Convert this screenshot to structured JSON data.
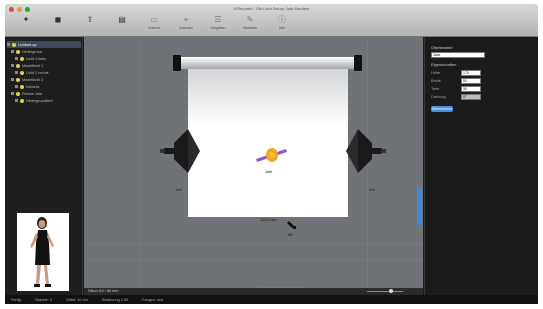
{
  "window": {
    "title": "A Reporter - Ein Licht Set-up Jule-Sanders"
  },
  "toolbar": {
    "tools": [
      {
        "label": "",
        "icon": "light-add-icon"
      },
      {
        "label": "",
        "icon": "camera-add-icon"
      },
      {
        "label": "",
        "icon": "export-icon"
      },
      {
        "label": "",
        "icon": "print-icon"
      },
      {
        "label": "Ansicht",
        "icon": "view-icon"
      },
      {
        "label": "Auswahl",
        "icon": "select-icon"
      },
      {
        "label": "Vorgaben",
        "icon": "presets-icon"
      },
      {
        "label": "Hinweise",
        "icon": "notes-icon"
      },
      {
        "label": "Info",
        "icon": "info-icon"
      }
    ]
  },
  "tree": {
    "rows": [
      {
        "label": "Lichtset-up",
        "selected": true
      },
      {
        "label": "Hintergrund",
        "selected": false
      },
      {
        "label": "Licht 1 links",
        "selected": false
      },
      {
        "label": "Modelllicht 1",
        "selected": false
      },
      {
        "label": "Licht 2 rechts",
        "selected": false
      },
      {
        "label": "Modelllicht 2",
        "selected": false
      },
      {
        "label": "Kamera",
        "selected": false
      },
      {
        "label": "Person Jule",
        "selected": false
      },
      {
        "label": "Hintergrundlicht",
        "selected": false
      }
    ]
  },
  "canvas": {
    "light_left_label": "2/4",
    "light_right_label": "2/4",
    "subject_label": "Jule",
    "distance_label": "120,0 cm",
    "camera_label": "f/8"
  },
  "status": {
    "text": "Nikon D3 / 85 mm",
    "zoom": "100 %"
  },
  "properties": {
    "section_title": "Objektname",
    "name_value": "Jule",
    "subsection_title": "Eigenschaften",
    "fields": [
      {
        "label": "Höhe",
        "value": "170"
      },
      {
        "label": "Breite",
        "value": "50"
      },
      {
        "label": "Tiefe",
        "value": "30"
      },
      {
        "label": "Drehung",
        "value": "0°"
      }
    ],
    "apply_label": "Übernehmen"
  },
  "bottombar": {
    "items": [
      "Fertig",
      "Objekte: 9",
      "Gitter: 10 cm",
      "Skalierung 1:50",
      "Fangen: aus"
    ]
  },
  "colors": {
    "accent": "#3f88d6",
    "canvas": "#6f7277"
  }
}
